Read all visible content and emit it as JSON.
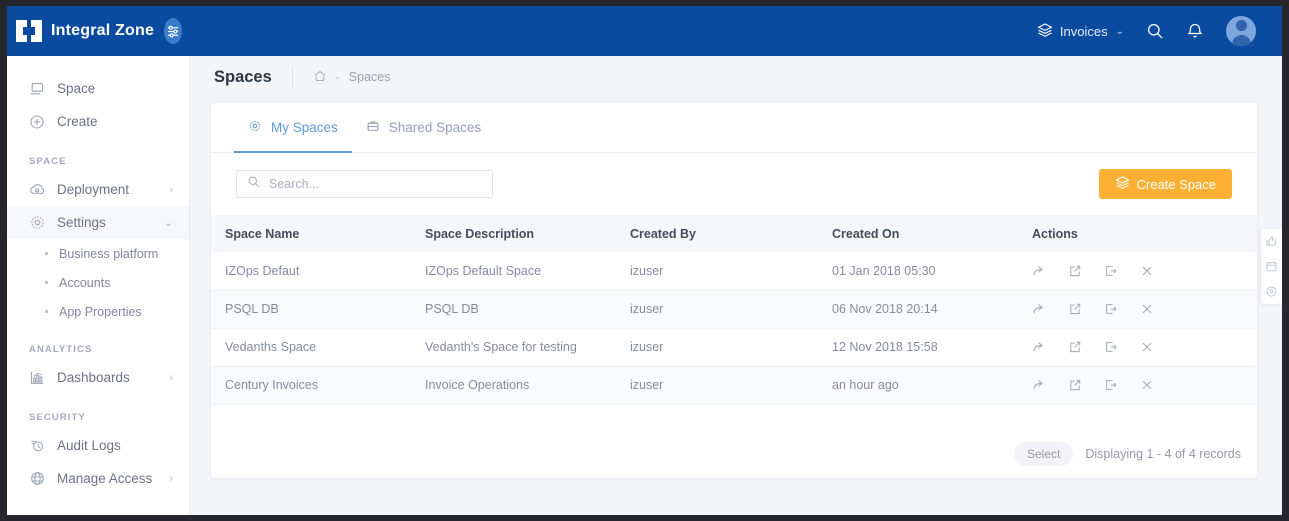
{
  "topbar": {
    "brand": "Integral Zone",
    "brand_badge_icon": "sliders-icon",
    "invoices_label": "Invoices",
    "invoices_icon": "layers-icon",
    "caret": "⌄",
    "search_icon": "search-icon",
    "notification_icon": "bell-icon",
    "avatar": "user-avatar",
    "bg_color": "#0a4ba0"
  },
  "sidebar": {
    "top_items": [
      {
        "label": "Space",
        "icon": "window-icon"
      },
      {
        "label": "Create",
        "icon": "plus-circle-icon"
      }
    ],
    "sections": [
      {
        "title": "SPACE",
        "items": [
          {
            "label": "Deployment",
            "icon": "cloud-icon",
            "chevron": "›",
            "active": false
          },
          {
            "label": "Settings",
            "icon": "gear-icon",
            "chevron": "⌄",
            "active": true
          }
        ],
        "sub_items": [
          "Business platform",
          "Accounts",
          "App Properties"
        ]
      },
      {
        "title": "ANALYTICS",
        "items": [
          {
            "label": "Dashboards",
            "icon": "chart-icon",
            "chevron": "›",
            "active": false
          }
        ],
        "sub_items": []
      },
      {
        "title": "SECURITY",
        "items": [
          {
            "label": "Audit Logs",
            "icon": "audit-icon",
            "chevron": "",
            "active": false
          },
          {
            "label": "Manage Access",
            "icon": "globe-icon",
            "chevron": "›",
            "active": false
          }
        ],
        "sub_items": []
      }
    ]
  },
  "page": {
    "title": "Spaces",
    "breadcrumb_home_icon": "home-icon",
    "breadcrumb_sep": "-",
    "breadcrumb_current": "Spaces"
  },
  "tabs": [
    {
      "label": "My Spaces",
      "icon": "gear-icon",
      "active": true
    },
    {
      "label": "Shared Spaces",
      "icon": "briefcase-icon",
      "active": false
    }
  ],
  "toolbar": {
    "search_placeholder": "Search...",
    "search_value": "",
    "search_icon": "search-icon",
    "create_label": "Create Space",
    "create_icon": "layers-icon",
    "create_color": "#fbb034"
  },
  "table": {
    "columns": [
      "Space Name",
      "Space Description",
      "Created By",
      "Created On",
      "Actions"
    ],
    "action_icons": [
      "share-icon",
      "edit-icon",
      "export-icon",
      "close-icon"
    ],
    "rows": [
      {
        "name": "IZOps Defaut",
        "description": "IZOps Default Space",
        "created_by": "izuser",
        "created_on": "01 Jan 2018 05:30"
      },
      {
        "name": "PSQL DB",
        "description": "PSQL DB",
        "created_by": "izuser",
        "created_on": "06 Nov 2018 20:14"
      },
      {
        "name": "Vedanths Space",
        "description": "Vedanth's Space for testing",
        "created_by": "izuser",
        "created_on": "12 Nov 2018 15:58"
      },
      {
        "name": "Century Invoices",
        "description": "Invoice Operations",
        "created_by": "izuser",
        "created_on": "an hour ago"
      }
    ]
  },
  "footer": {
    "select_label": "Select",
    "records_text": "Displaying 1 - 4 of 4 records"
  },
  "side_rail": [
    {
      "icon": "thumbs-up-icon"
    },
    {
      "icon": "calendar-icon"
    },
    {
      "icon": "settings-circle-icon"
    }
  ]
}
